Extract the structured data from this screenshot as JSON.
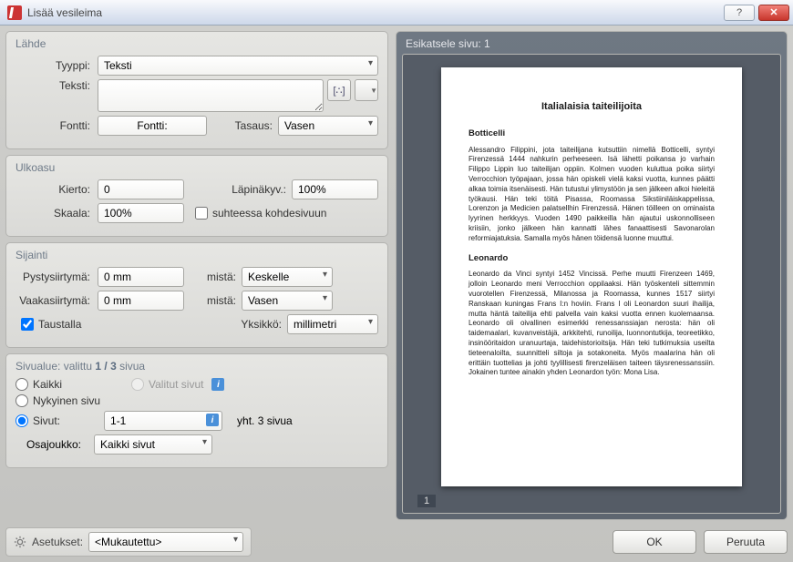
{
  "window": {
    "title": "Lisää vesileima"
  },
  "source": {
    "title": "Lähde",
    "type_label": "Tyyppi:",
    "type_value": "Teksti",
    "text_label": "Teksti:",
    "text_value": "",
    "insert_field_symbol": "[∴]",
    "font_label": "Fontti:",
    "font_button": "Fontti:",
    "align_label": "Tasaus:",
    "align_value": "Vasen"
  },
  "appearance": {
    "title": "Ulkoasu",
    "rotation_label": "Kierto:",
    "rotation_value": "0",
    "opacity_label": "Läpinäkyv.:",
    "opacity_value": "100%",
    "scale_label": "Skaala:",
    "scale_value": "100%",
    "relative_label": "suhteessa kohdesivuun",
    "relative_checked": false
  },
  "location": {
    "title": "Sijainti",
    "voffset_label": "Pystysiirtymä:",
    "voffset_value": "0 mm",
    "voffset_from_label": "mistä:",
    "voffset_from_value": "Keskelle",
    "hoffset_label": "Vaakasiirtymä:",
    "hoffset_value": "0 mm",
    "hoffset_from_label": "mistä:",
    "hoffset_from_value": "Vasen",
    "background_label": "Taustalla",
    "background_checked": true,
    "unit_label": "Yksikkö:",
    "unit_value": "millimetri"
  },
  "range": {
    "title_prefix": "Sivualue: valittu ",
    "title_count": "1 / 3",
    "title_suffix": " sivua",
    "all_label": "Kaikki",
    "selected_label": "Valitut sivut",
    "current_label": "Nykyinen sivu",
    "pages_label": "Sivut:",
    "pages_value": "1-1",
    "pages_total": "yht. 3 sivua",
    "subset_label": "Osajoukko:",
    "subset_value": "Kaikki sivut",
    "checked": "pages"
  },
  "preview": {
    "title": "Esikatsele sivu: 1",
    "page_number": "1",
    "doc": {
      "h1": "Italialaisia taiteilijoita",
      "h2a": "Botticelli",
      "p1": "Alessandro Filippini, jota taiteilijana kutsuttiin nimellä Botticelli, syntyi Firenzessä 1444 nahkurin perheeseen. Isä lähetti poikansa jo varhain Filippo Lippin luo taiteilijan oppiin. Kolmen vuoden kuluttua poika siirtyi Verrocchion työpajaan, jossa hän opiskeli vielä kaksi vuotta, kunnes päätti alkaa toimia itsenäisesti. Hän tutustui ylimystöön ja sen jälkeen alkoi hieleitä työkausi. Hän teki töitä Pisassa, Roomassa Sikstiiniläiskappelissa, Lorenzon ja Medicien palatsellhin Firenzessä. Hänen töilleen on ominaista lyyrinen herkkyys. Vuoden 1490 paikkeilla hän ajautui uskonnolliseen kriisiin, jonko jälkeen hän kannatti lähes fanaattisesti Savonarolan reformiajatuksia. Samalla myös hänen töidensä luonne muuttui.",
      "h2b": "Leonardo",
      "p2": "Leonardo da Vinci syntyi 1452 Vincissä. Perhe muutti Firenzeen 1469, jolloin Leonardo meni Verrocchion oppilaaksi. Hän työskenteli sittemmin vuorotellen Firenzessä, Milanossa ja Roomassa, kunnes 1517 siirtyi Ranskaan kuningas Frans I:n hoviin. Frans I oli Leonardon suuri ihailija, mutta häntä taiteilija ehti palvella vain kaksi vuotta ennen kuolemaansa. Leonardo oli oivallinen esimerkki renessanssiajan nerosta: hän oli taidemaalari, kuvanveistäjä, arkkitehti, runoilija, luonnontutkija, teoreetikko, insinööritaidon uranuurtaja, taidehistorioitsija. Hän teki tutkimuksia useilta tieteenaloilta, suunnitteli siltoja ja sotakoneita. Myös maalarina hän oli erittäin tuottelias ja johti tyylillisesti firenzeläisen taiteen täysrenessanssiin. Jokainen tuntee ainakin yhden Leonardon työn: Mona Lisa."
    }
  },
  "footer": {
    "settings_label": "Asetukset:",
    "settings_value": "<Mukautettu>",
    "ok": "OK",
    "cancel": "Peruuta"
  }
}
